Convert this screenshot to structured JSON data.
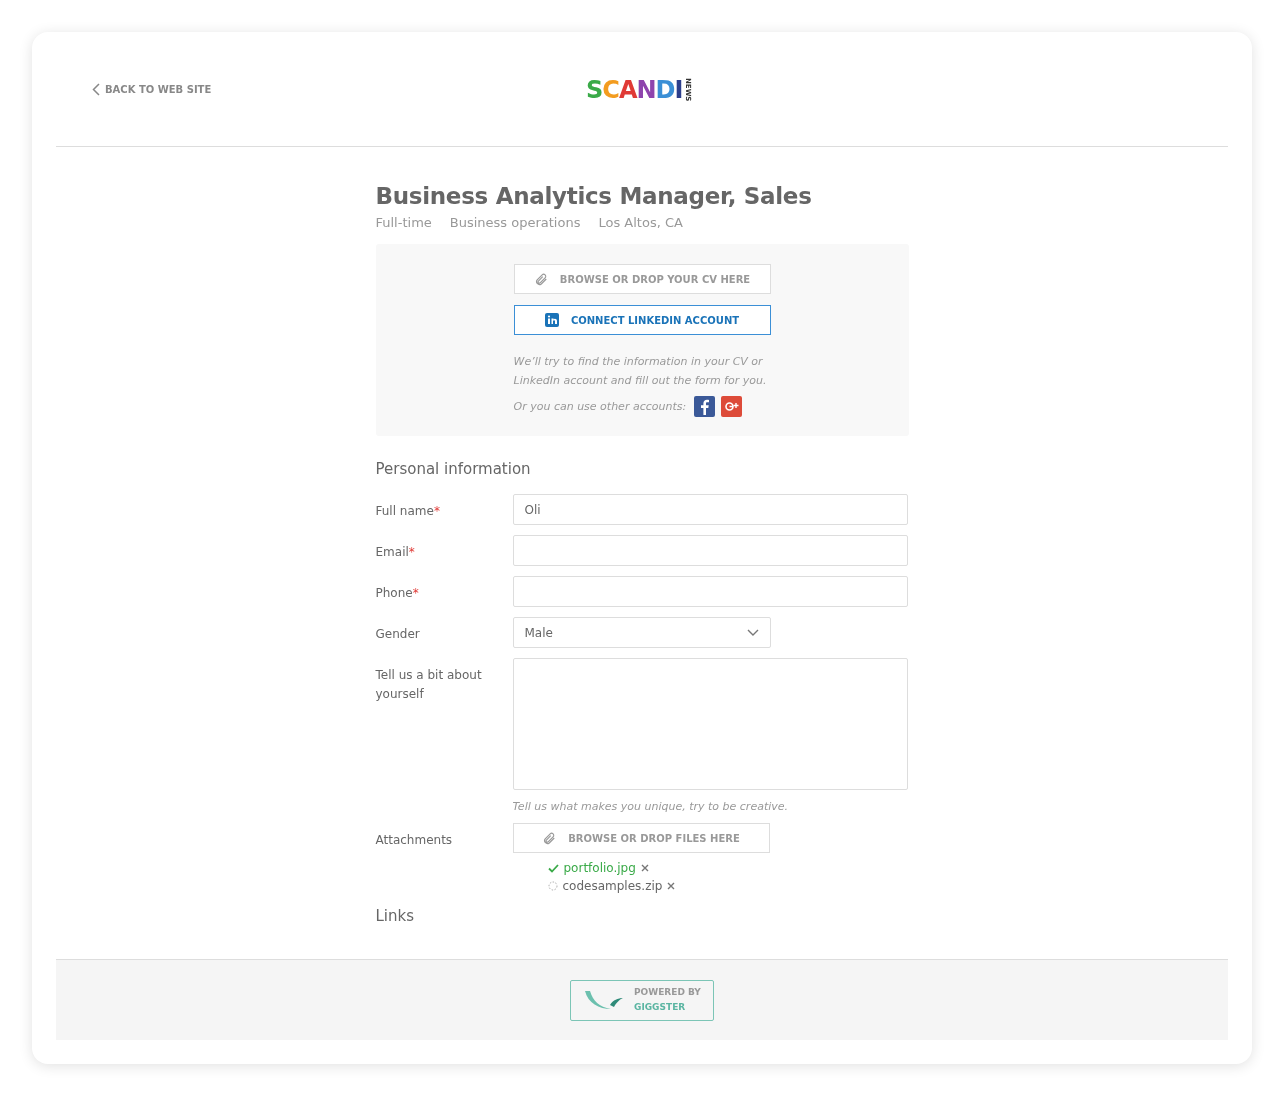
{
  "header": {
    "back_link": "BACK TO WEB SITE",
    "logo": {
      "letters": [
        {
          "text": "S",
          "color": "#3aaa48"
        },
        {
          "text": "C",
          "color": "#f39c1f"
        },
        {
          "text": "A",
          "color": "#e03a36"
        },
        {
          "text": "N",
          "color": "#8e44ad"
        },
        {
          "text": "D",
          "color": "#3b8fd6"
        },
        {
          "text": "I",
          "color": "#2c3e8c"
        }
      ],
      "tag": "NEWS"
    }
  },
  "job": {
    "title": "Business Analytics Manager, Sales",
    "meta": [
      "Full-time",
      "Business operations",
      "Los Altos, CA"
    ]
  },
  "import_panel": {
    "cv_button": "BROWSE OR DROP YOUR CV HERE",
    "linkedin_button": "CONNECT LINKEDIN ACCOUNT",
    "hint": "We’ll try to find the information in your CV or LinkedIn account and fill out the form for you.",
    "other_accounts": "Or you can use other accounts:"
  },
  "personal": {
    "heading": "Personal information",
    "fields": [
      {
        "label": "Full name",
        "required_marker": "*",
        "kind": "text",
        "value": "Oli"
      },
      {
        "label": "Email",
        "required_marker": "*",
        "kind": "text"
      },
      {
        "label": "Phone",
        "required_marker": "*",
        "kind": "text"
      },
      {
        "label": "Gender",
        "kind": "select",
        "value": "Male"
      },
      {
        "label": "Tell us a bit about yourself",
        "kind": "textarea",
        "hint": "Tell us what makes you unique, try to be creative."
      }
    ]
  },
  "attachments": {
    "label": "Attachments",
    "button": "BROWSE OR DROP FILES HERE",
    "files": [
      {
        "name": "portfolio.jpg",
        "kind": "done"
      },
      {
        "name": "codesamples.zip",
        "kind": "uploading"
      }
    ]
  },
  "links": {
    "heading": "Links"
  },
  "footer": {
    "powered_by": "POWERED BY",
    "brand": "GIGGSTER"
  }
}
